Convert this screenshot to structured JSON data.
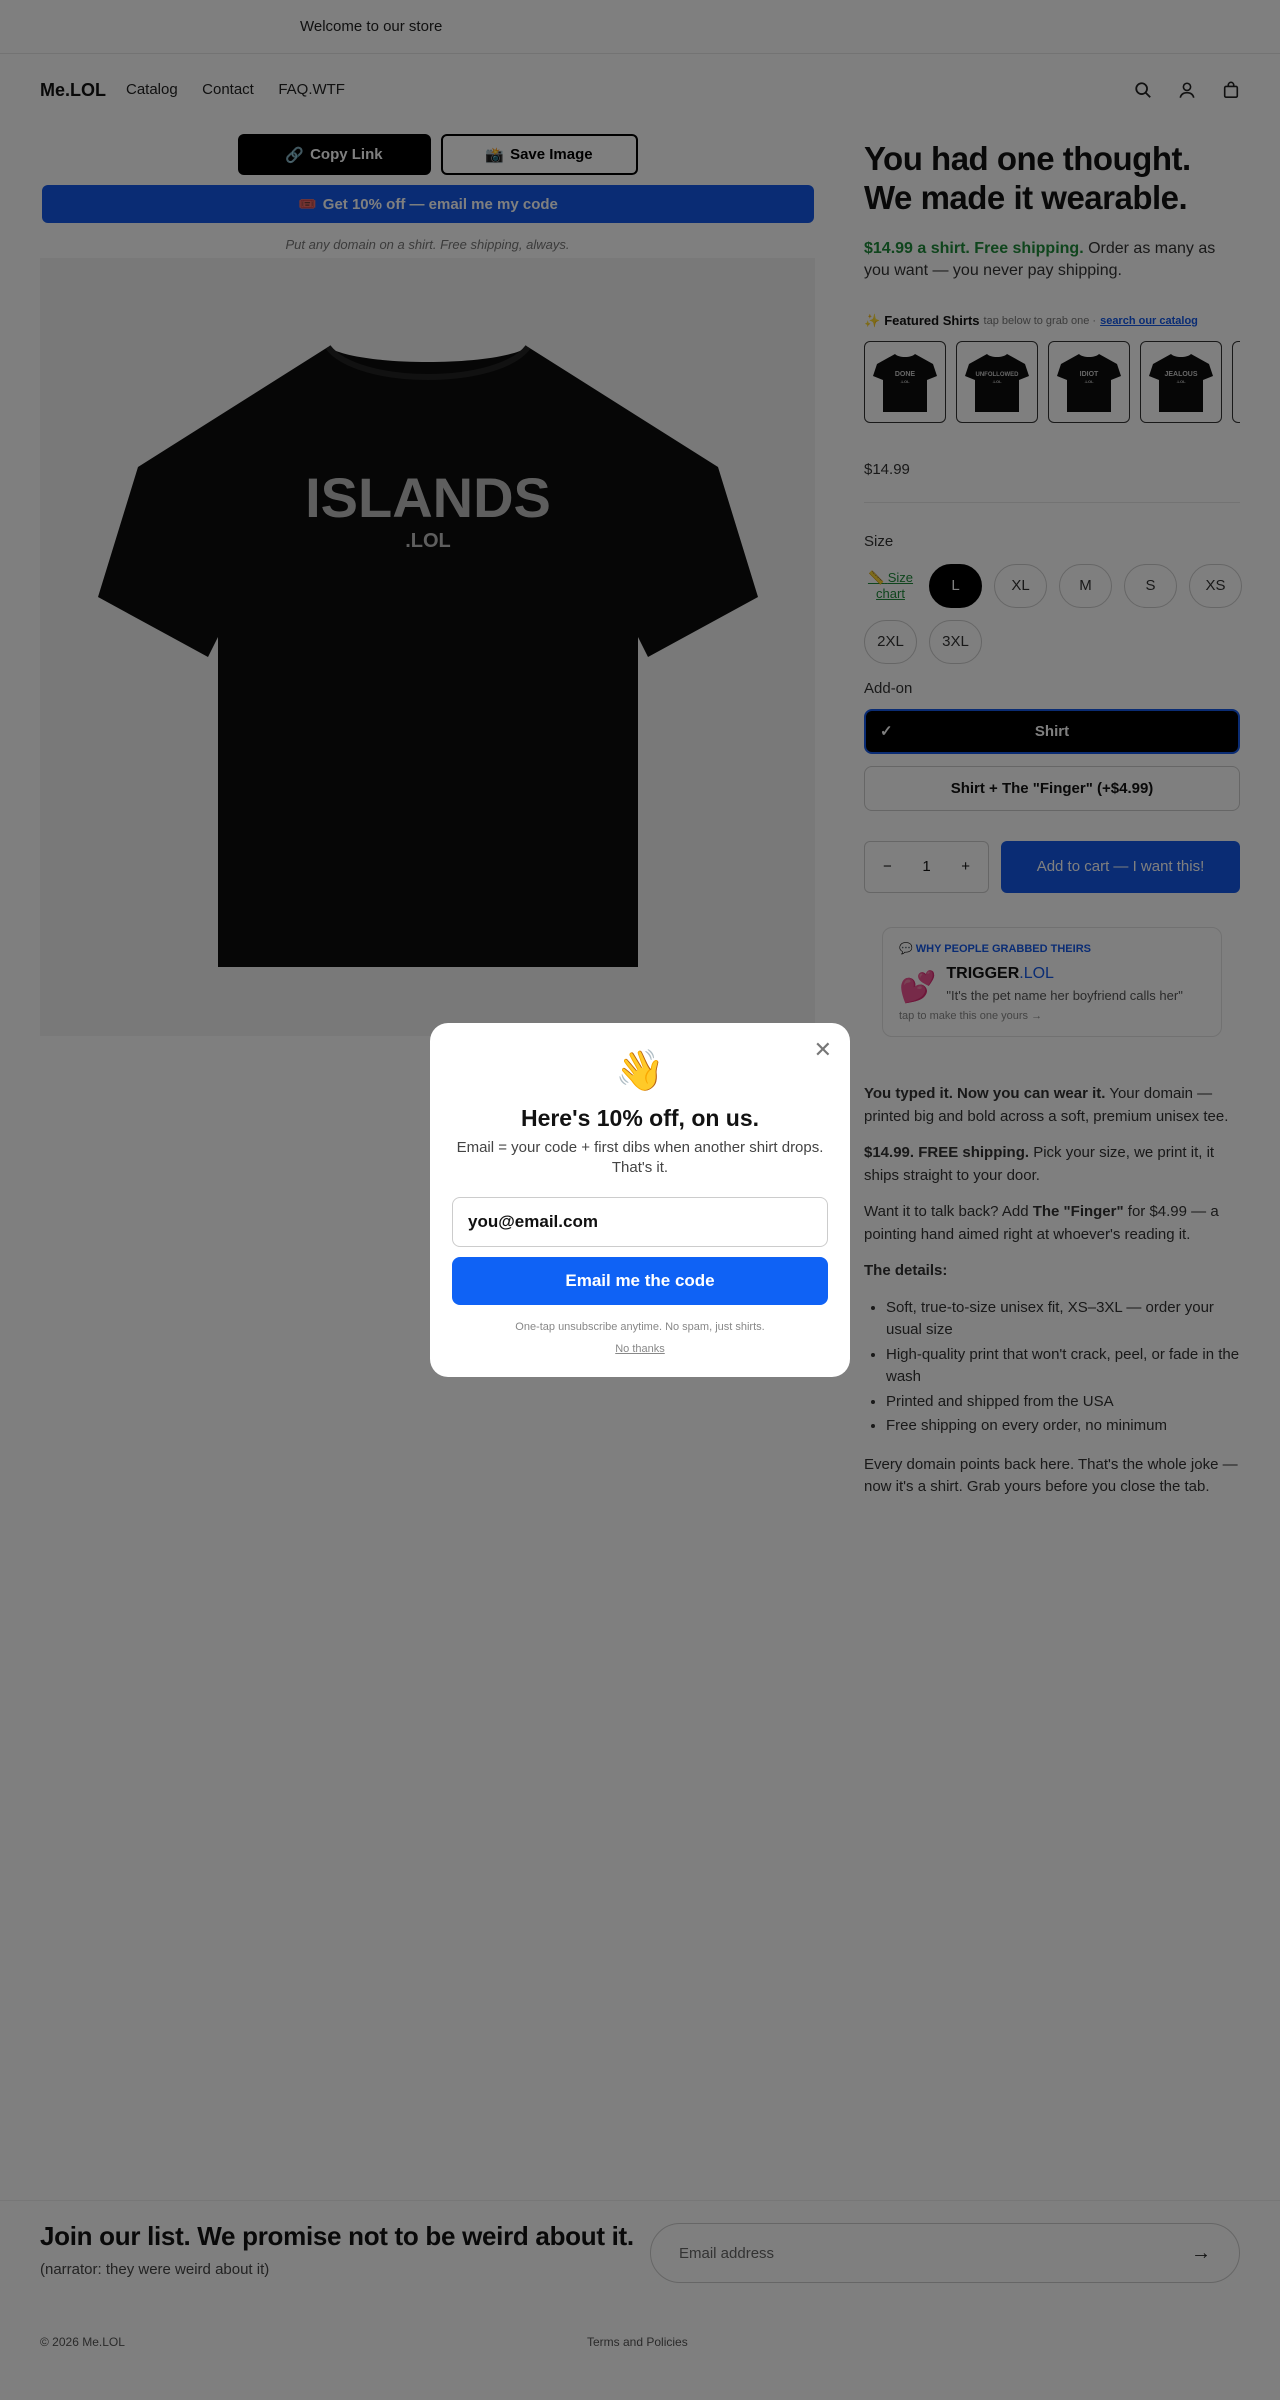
{
  "announcement": "Welcome to our store",
  "header": {
    "logo": "Me.LOL",
    "nav": [
      "Catalog",
      "Contact",
      "FAQ.WTF"
    ]
  },
  "left": {
    "copy_link": "Copy Link",
    "copy_link_emoji": "🔗",
    "save_image": "Save Image",
    "save_image_emoji": "📸",
    "discount_button": "Get 10% off — email me my code",
    "discount_emoji": "🎟️",
    "tagline": "Put any domain on a shirt. Free shipping, always.",
    "shirt_main_text": "ISLANDS",
    "shirt_sub_text": ".LOL"
  },
  "right": {
    "headline_line1": "You had one thought.",
    "headline_line2": "We made it wearable.",
    "price_green": "$14.99 a shirt. Free shipping.",
    "price_rest": " Order as many as you want — you never pay shipping.",
    "featured_emoji": "✨",
    "featured_label": "Featured Shirts",
    "featured_small": "tap below to grab one ·",
    "featured_link": "search our catalog",
    "thumbs": [
      {
        "main": "DONE",
        "sub": ".LOL"
      },
      {
        "main": "UNFOLLOWED",
        "sub": ".LOL"
      },
      {
        "main": "IDIOT",
        "sub": ".LOL"
      },
      {
        "main": "JEALOUS",
        "sub": ".LOL"
      },
      {
        "main": "",
        "sub": ""
      }
    ],
    "price": "$14.99",
    "size_label": "Size",
    "size_chart_emoji": "📏",
    "size_chart": "Size chart",
    "sizes": [
      "L",
      "XL",
      "M",
      "S",
      "XS",
      "2XL",
      "3XL"
    ],
    "selected_size": "L",
    "addon_label": "Add-on",
    "addon_selected_check": "✓",
    "addon_options": [
      "Shirt",
      "Shirt + The \"Finger\" (+$4.99)"
    ],
    "qty_minus": "−",
    "qty_value": "1",
    "qty_plus": "+",
    "add_to_cart": "Add to cart — I want this!",
    "why_emoji": "💬",
    "why_title": "WHY PEOPLE GRABBED THEIRS",
    "why_heart": "💕",
    "why_name_main": "TRIGGER",
    "why_name_tld": ".LOL",
    "why_quote": "\"It's the pet name her boyfriend calls her\"",
    "why_tap": "tap to make this one yours →",
    "desc_p1_bold": "You typed it. Now you can wear it.",
    "desc_p1_rest": " Your domain — printed big and bold across a soft, premium unisex tee.",
    "desc_p2_bold": "$14.99. FREE shipping.",
    "desc_p2_rest": " Pick your size, we print it, it ships straight to your door.",
    "desc_p3_a": "Want it to talk back? Add ",
    "desc_p3_bold": "The \"Finger\"",
    "desc_p3_b": " for $4.99 — a pointing hand aimed right at whoever's reading it.",
    "details_title": "The details:",
    "details": [
      "Soft, true-to-size unisex fit, XS–3XL — order your usual size",
      "High-quality print that won't crack, peel, or fade in the wash",
      "Printed and shipped from the USA",
      "Free shipping on every order, no minimum"
    ],
    "closing": "Every domain points back here. That's the whole joke — now it's a shirt. Grab yours before you close the tab."
  },
  "footer": {
    "join_title": "Join our list. We promise not to be weird about it.",
    "join_sub": "(narrator: they were weird about it)",
    "email_placeholder": "Email address",
    "arrow": "→",
    "copyright": "© 2026 Me.LOL",
    "terms": "Terms and Policies"
  },
  "modal": {
    "close": "✕",
    "wave": "👋",
    "title": "Here's 10% off, on us.",
    "subtitle": "Email = your code + first dibs when another shirt drops. That's it.",
    "input_value": "you@email.com",
    "button": "Email me the code",
    "fine_print": "One-tap unsubscribe anytime. No spam, just shirts.",
    "no_thanks": "No thanks"
  },
  "colors": {
    "accent_blue": "#1559e8",
    "green": "#1f8a3a",
    "overlay": "rgba(0,0,0,0.5)"
  }
}
